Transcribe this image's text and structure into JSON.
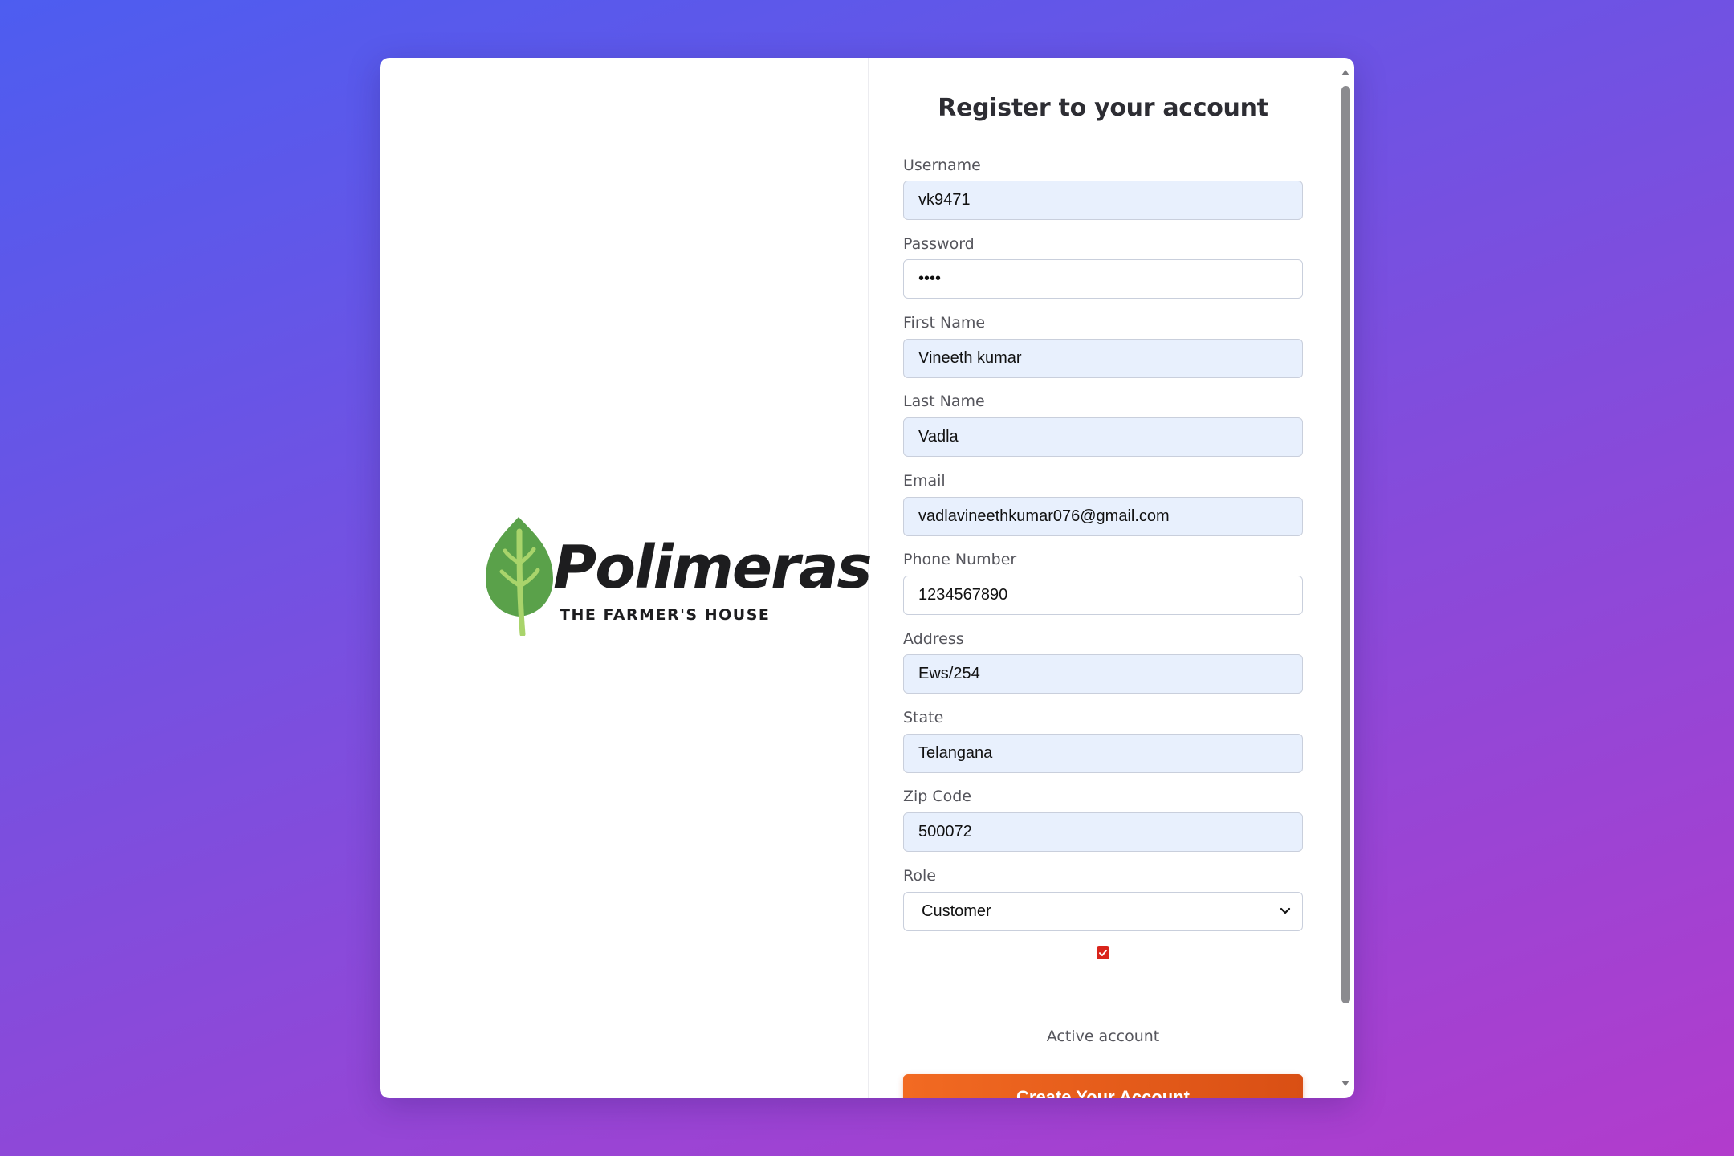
{
  "logo": {
    "name": "Polimeras",
    "tagline": "THE FARMER'S HOUSE",
    "icon": "leaf-icon",
    "leaf_color": "#5aa14a",
    "stem_color": "#a9d46b"
  },
  "form": {
    "title": "Register to your account",
    "fields": {
      "username": {
        "label": "Username",
        "value": "vk9471"
      },
      "password": {
        "label": "Password",
        "value": "••••"
      },
      "first_name": {
        "label": "First Name",
        "value": "Vineeth kumar"
      },
      "last_name": {
        "label": "Last Name",
        "value": "Vadla"
      },
      "email": {
        "label": "Email",
        "value": "vadlavineethkumar076@gmail.com"
      },
      "phone": {
        "label": "Phone Number",
        "value": "1234567890"
      },
      "address": {
        "label": "Address",
        "value": "Ews/254"
      },
      "state": {
        "label": "State",
        "value": "Telangana"
      },
      "zip": {
        "label": "Zip Code",
        "value": "500072"
      },
      "role": {
        "label": "Role",
        "value": "Customer"
      }
    },
    "active": {
      "label": "Active account",
      "checked": true
    },
    "submit_label": "Create Your Account"
  },
  "colors": {
    "accent": "#f26a22",
    "checkbox": "#d9241b",
    "autofill_bg": "#e8f0fd"
  }
}
